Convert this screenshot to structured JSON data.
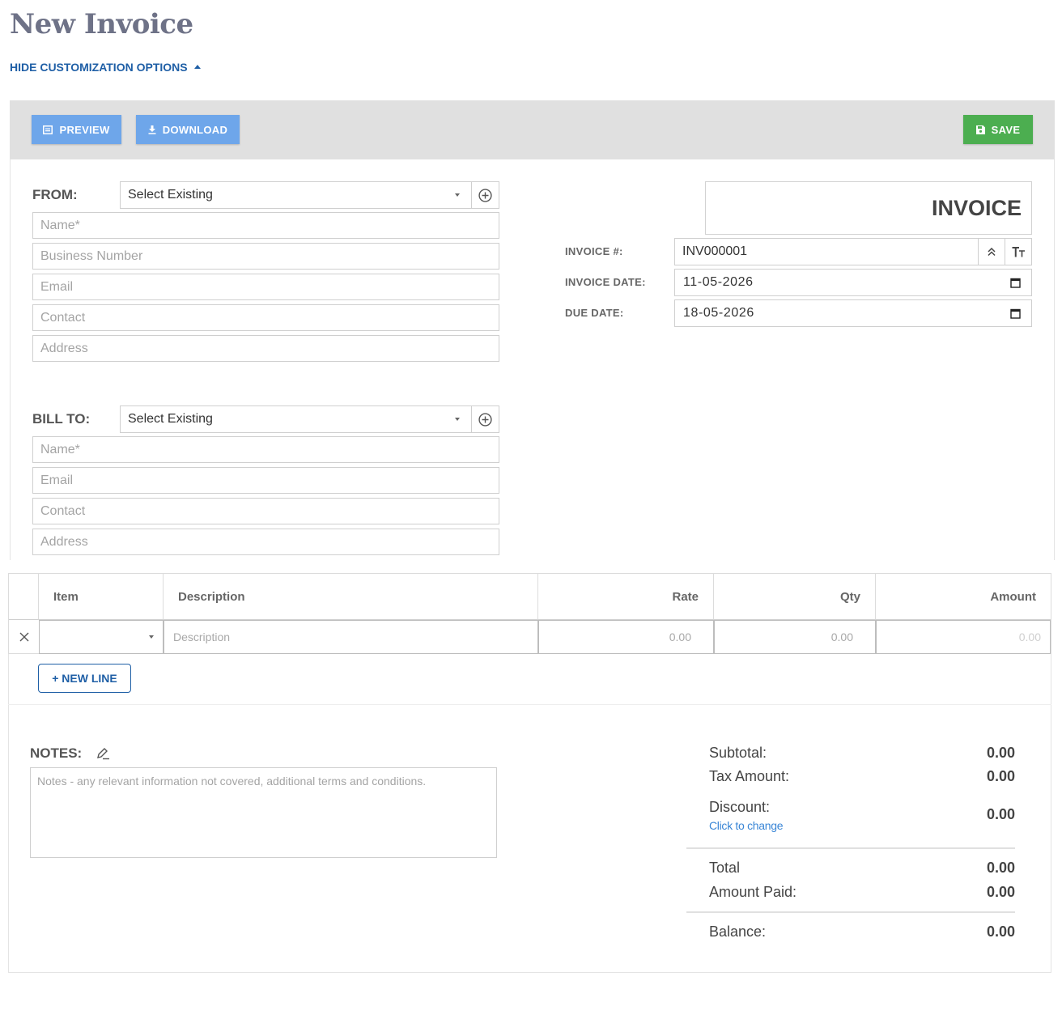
{
  "page": {
    "title": "New Invoice",
    "customize_label": "HIDE CUSTOMIZATION OPTIONS"
  },
  "toolbar": {
    "preview_label": "PREVIEW",
    "download_label": "DOWNLOAD",
    "save_label": "SAVE"
  },
  "from": {
    "label": "FROM:",
    "select_value": "Select Existing",
    "fields": {
      "name": "Name*",
      "business_number": "Business Number",
      "email": "Email",
      "contact": "Contact",
      "address": "Address"
    }
  },
  "bill_to": {
    "label": "BILL TO:",
    "select_value": "Select Existing",
    "fields": {
      "name": "Name*",
      "email": "Email",
      "contact": "Contact",
      "address": "Address"
    }
  },
  "invoice": {
    "title": "INVOICE",
    "number_label": "INVOICE #:",
    "number_value": "INV000001",
    "date_label": "INVOICE DATE:",
    "date_value": "11-05-2026",
    "due_label": "DUE DATE:",
    "due_value": "18-05-2026"
  },
  "items_table": {
    "headers": {
      "item": "Item",
      "description": "Description",
      "rate": "Rate",
      "qty": "Qty",
      "amount": "Amount"
    },
    "rows": [
      {
        "description_placeholder": "Description",
        "rate": "0.00",
        "qty": "0.00",
        "amount": "0.00"
      }
    ],
    "new_line_label": "+ NEW LINE"
  },
  "notes": {
    "label": "NOTES:",
    "placeholder": "Notes - any relevant information not covered, additional terms and conditions."
  },
  "summary": {
    "subtotal_label": "Subtotal:",
    "subtotal_value": "0.00",
    "tax_label": "Tax Amount:",
    "tax_value": "0.00",
    "discount_label": "Discount:",
    "discount_value": "0.00",
    "discount_link": "Click to change",
    "total_label": "Total",
    "total_value": "0.00",
    "paid_label": "Amount Paid:",
    "paid_value": "0.00",
    "balance_label": "Balance:",
    "balance_value": "0.00"
  },
  "colors": {
    "primary_blue": "#1f5fa6",
    "button_blue": "#6ea6ea",
    "save_green": "#4cae50",
    "title_gray": "#6e7287"
  }
}
